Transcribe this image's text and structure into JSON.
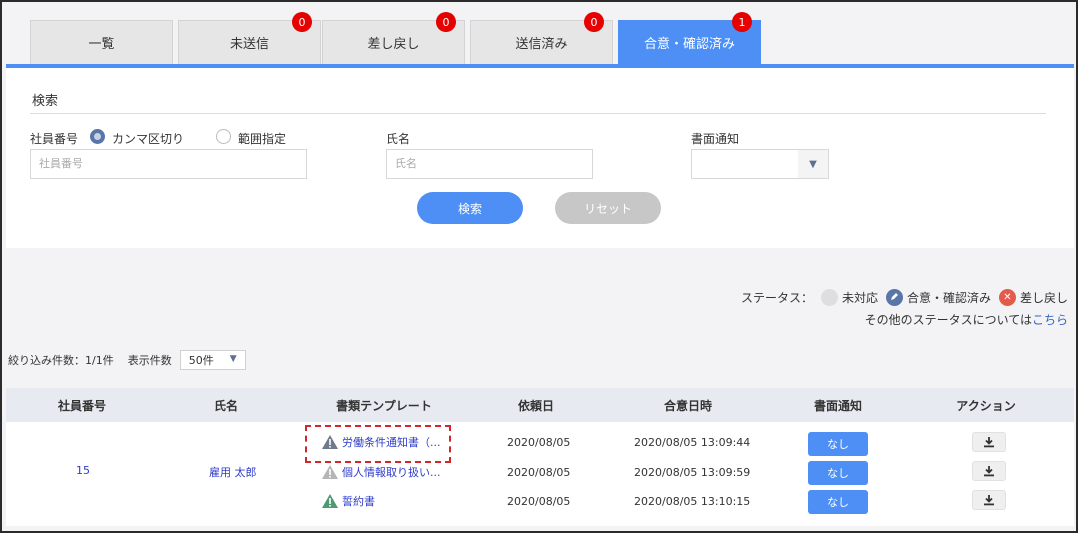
{
  "tabs": [
    {
      "label": "一覧",
      "badge": ""
    },
    {
      "label": "未送信",
      "badge": "0"
    },
    {
      "label": "差し戻し",
      "badge": "0"
    },
    {
      "label": "送信済み",
      "badge": "0"
    },
    {
      "label": "合意・確認済み",
      "badge": "1"
    }
  ],
  "search": {
    "title": "検索",
    "employee_label": "社員番号",
    "radio_comma": "カンマ区切り",
    "radio_range": "範囲指定",
    "employee_placeholder": "社員番号",
    "name_label": "氏名",
    "name_placeholder": "氏名",
    "notice_label": "書面通知",
    "notice_value": "",
    "search_button": "検索",
    "reset_button": "リセット"
  },
  "status": {
    "label": "ステータス：",
    "unhandled": "未対応",
    "agreed": "合意・確認済み",
    "returned": "差し戻し",
    "note_prefix": "その他のステータスについては",
    "note_link": "こちら"
  },
  "list": {
    "count_text": "絞り込み件数：1/1件",
    "per_page_label": "表示件数",
    "per_page_value": "50件"
  },
  "table": {
    "headers": [
      "社員番号",
      "氏名",
      "書類テンプレート",
      "依頼日",
      "合意日時",
      "書面通知",
      "アクション"
    ],
    "employee_id": "15",
    "employee_name": "雇用 太郎",
    "rows": [
      {
        "template": "労働条件通知書（...",
        "request_date": "2020/08/05",
        "agreed_at": "2020/08/05 13:09:44",
        "notice": "なし",
        "warn_color": "#707a8c"
      },
      {
        "template": "個人情報取り扱い...",
        "request_date": "2020/08/05",
        "agreed_at": "2020/08/05 13:09:59",
        "notice": "なし",
        "warn_color": "#b5b5b5"
      },
      {
        "template": "誓約書",
        "request_date": "2020/08/05",
        "agreed_at": "2020/08/05 13:10:15",
        "notice": "なし",
        "warn_color": "#4f9a73"
      }
    ]
  },
  "colors": {
    "primary": "#4d8ff5",
    "badge": "#e60000",
    "link": "#2e3cc9"
  }
}
